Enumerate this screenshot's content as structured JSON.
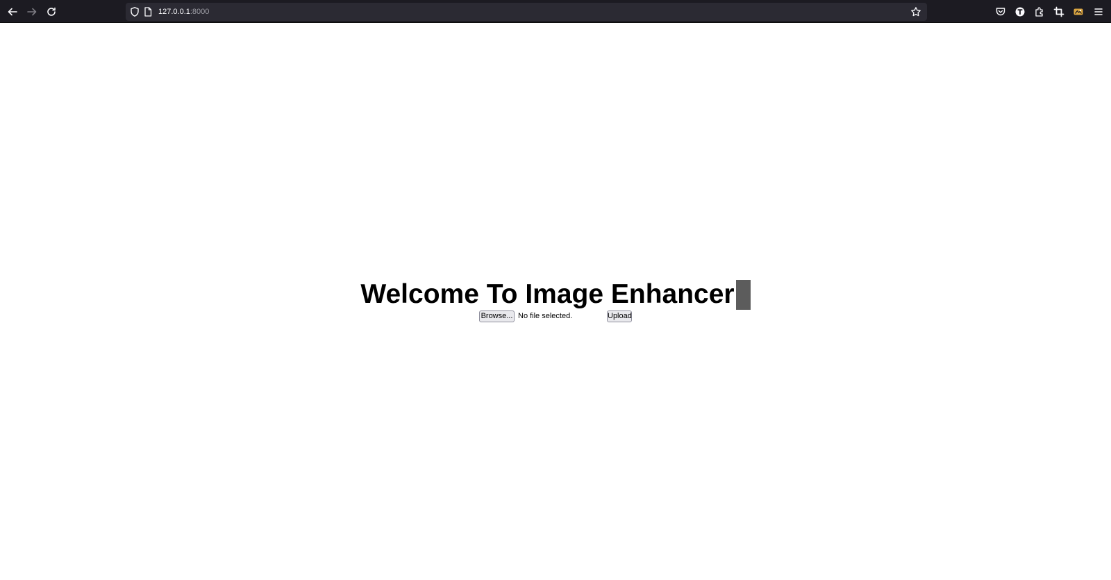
{
  "browser": {
    "address": {
      "host": "127.0.0.1",
      "port": ":8000"
    },
    "icons": {
      "back": "back-arrow-icon",
      "forward": "forward-arrow-icon",
      "reload": "reload-icon",
      "tracking_protection": "shield-icon",
      "page_info": "page-icon",
      "bookmark": "star-icon",
      "pocket": "pocket-icon",
      "account": "account-icon",
      "extensions": "puzzle-icon",
      "crop": "crop-icon",
      "extension_badge": "extension-badge-icon",
      "menu": "hamburger-menu-icon"
    },
    "colors": {
      "toolbar": "#1c1b22",
      "urlbar": "#2b2a33",
      "icon": "#fbfbfe"
    }
  },
  "page": {
    "title": "Welcome To Image Enhancer",
    "file_input": {
      "button_label": "Browse...",
      "status": "No file selected."
    },
    "upload_label": "Upload"
  }
}
